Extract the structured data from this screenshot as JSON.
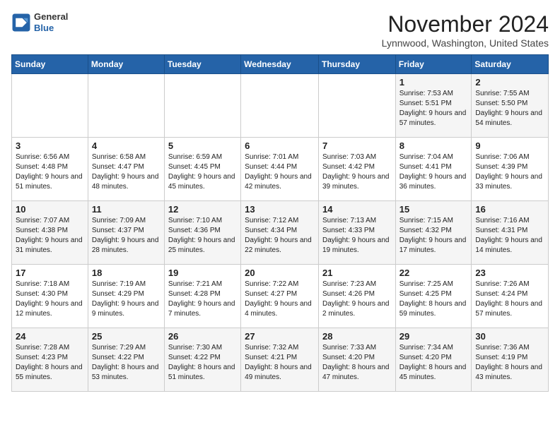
{
  "header": {
    "logo_line1": "General",
    "logo_line2": "Blue",
    "month": "November 2024",
    "location": "Lynnwood, Washington, United States"
  },
  "weekdays": [
    "Sunday",
    "Monday",
    "Tuesday",
    "Wednesday",
    "Thursday",
    "Friday",
    "Saturday"
  ],
  "weeks": [
    [
      {
        "day": "",
        "info": ""
      },
      {
        "day": "",
        "info": ""
      },
      {
        "day": "",
        "info": ""
      },
      {
        "day": "",
        "info": ""
      },
      {
        "day": "",
        "info": ""
      },
      {
        "day": "1",
        "info": "Sunrise: 7:53 AM\nSunset: 5:51 PM\nDaylight: 9 hours and 57 minutes."
      },
      {
        "day": "2",
        "info": "Sunrise: 7:55 AM\nSunset: 5:50 PM\nDaylight: 9 hours and 54 minutes."
      }
    ],
    [
      {
        "day": "3",
        "info": "Sunrise: 6:56 AM\nSunset: 4:48 PM\nDaylight: 9 hours and 51 minutes."
      },
      {
        "day": "4",
        "info": "Sunrise: 6:58 AM\nSunset: 4:47 PM\nDaylight: 9 hours and 48 minutes."
      },
      {
        "day": "5",
        "info": "Sunrise: 6:59 AM\nSunset: 4:45 PM\nDaylight: 9 hours and 45 minutes."
      },
      {
        "day": "6",
        "info": "Sunrise: 7:01 AM\nSunset: 4:44 PM\nDaylight: 9 hours and 42 minutes."
      },
      {
        "day": "7",
        "info": "Sunrise: 7:03 AM\nSunset: 4:42 PM\nDaylight: 9 hours and 39 minutes."
      },
      {
        "day": "8",
        "info": "Sunrise: 7:04 AM\nSunset: 4:41 PM\nDaylight: 9 hours and 36 minutes."
      },
      {
        "day": "9",
        "info": "Sunrise: 7:06 AM\nSunset: 4:39 PM\nDaylight: 9 hours and 33 minutes."
      }
    ],
    [
      {
        "day": "10",
        "info": "Sunrise: 7:07 AM\nSunset: 4:38 PM\nDaylight: 9 hours and 31 minutes."
      },
      {
        "day": "11",
        "info": "Sunrise: 7:09 AM\nSunset: 4:37 PM\nDaylight: 9 hours and 28 minutes."
      },
      {
        "day": "12",
        "info": "Sunrise: 7:10 AM\nSunset: 4:36 PM\nDaylight: 9 hours and 25 minutes."
      },
      {
        "day": "13",
        "info": "Sunrise: 7:12 AM\nSunset: 4:34 PM\nDaylight: 9 hours and 22 minutes."
      },
      {
        "day": "14",
        "info": "Sunrise: 7:13 AM\nSunset: 4:33 PM\nDaylight: 9 hours and 19 minutes."
      },
      {
        "day": "15",
        "info": "Sunrise: 7:15 AM\nSunset: 4:32 PM\nDaylight: 9 hours and 17 minutes."
      },
      {
        "day": "16",
        "info": "Sunrise: 7:16 AM\nSunset: 4:31 PM\nDaylight: 9 hours and 14 minutes."
      }
    ],
    [
      {
        "day": "17",
        "info": "Sunrise: 7:18 AM\nSunset: 4:30 PM\nDaylight: 9 hours and 12 minutes."
      },
      {
        "day": "18",
        "info": "Sunrise: 7:19 AM\nSunset: 4:29 PM\nDaylight: 9 hours and 9 minutes."
      },
      {
        "day": "19",
        "info": "Sunrise: 7:21 AM\nSunset: 4:28 PM\nDaylight: 9 hours and 7 minutes."
      },
      {
        "day": "20",
        "info": "Sunrise: 7:22 AM\nSunset: 4:27 PM\nDaylight: 9 hours and 4 minutes."
      },
      {
        "day": "21",
        "info": "Sunrise: 7:23 AM\nSunset: 4:26 PM\nDaylight: 9 hours and 2 minutes."
      },
      {
        "day": "22",
        "info": "Sunrise: 7:25 AM\nSunset: 4:25 PM\nDaylight: 8 hours and 59 minutes."
      },
      {
        "day": "23",
        "info": "Sunrise: 7:26 AM\nSunset: 4:24 PM\nDaylight: 8 hours and 57 minutes."
      }
    ],
    [
      {
        "day": "24",
        "info": "Sunrise: 7:28 AM\nSunset: 4:23 PM\nDaylight: 8 hours and 55 minutes."
      },
      {
        "day": "25",
        "info": "Sunrise: 7:29 AM\nSunset: 4:22 PM\nDaylight: 8 hours and 53 minutes."
      },
      {
        "day": "26",
        "info": "Sunrise: 7:30 AM\nSunset: 4:22 PM\nDaylight: 8 hours and 51 minutes."
      },
      {
        "day": "27",
        "info": "Sunrise: 7:32 AM\nSunset: 4:21 PM\nDaylight: 8 hours and 49 minutes."
      },
      {
        "day": "28",
        "info": "Sunrise: 7:33 AM\nSunset: 4:20 PM\nDaylight: 8 hours and 47 minutes."
      },
      {
        "day": "29",
        "info": "Sunrise: 7:34 AM\nSunset: 4:20 PM\nDaylight: 8 hours and 45 minutes."
      },
      {
        "day": "30",
        "info": "Sunrise: 7:36 AM\nSunset: 4:19 PM\nDaylight: 8 hours and 43 minutes."
      }
    ]
  ]
}
